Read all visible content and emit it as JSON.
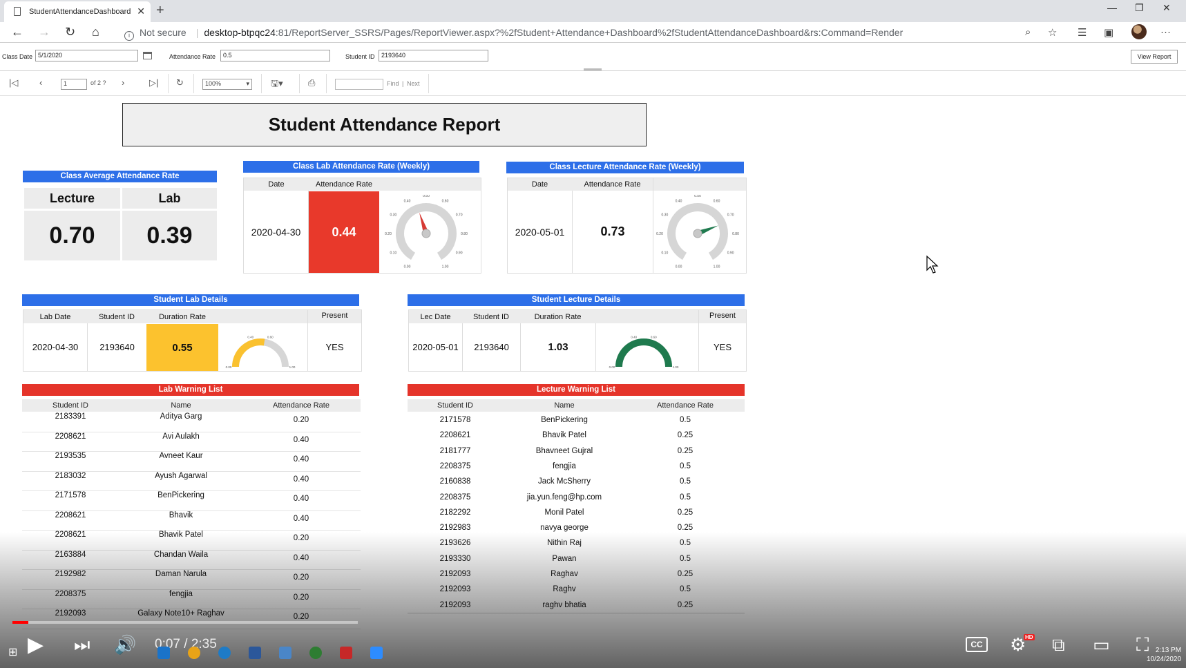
{
  "browser": {
    "tab_title": "StudentAttendanceDashboard -",
    "security": "Not secure",
    "url_host": "desktop-btpqc24",
    "url_path": ":81/ReportServer_SSRS/Pages/ReportViewer.aspx?%2fStudent+Attendance+Dashboard%2fStudentAttendanceDashboard&rs:Command=Render"
  },
  "params": {
    "class_date_label": "Class Date",
    "class_date_value": "5/1/2020",
    "attendance_rate_label": "Attendance Rate",
    "attendance_rate_value": "0.5",
    "student_id_label": "Student ID",
    "student_id_value": "2193640",
    "view_report": "View Report"
  },
  "toolbar": {
    "page_value": "1",
    "of_pages": "of 2 ?",
    "zoom": "100%",
    "find": "Find",
    "separator": "|",
    "next": "Next"
  },
  "report": {
    "title": "Student Attendance Report",
    "class_avg": {
      "header": "Class Average Attendance Rate",
      "lecture_label": "Lecture",
      "lab_label": "Lab",
      "lecture_value": "0.70",
      "lab_value": "0.39"
    },
    "lab_weekly": {
      "header": "Class Lab Attendance Rate (Weekly)",
      "col_date": "Date",
      "col_rate": "Attendance Rate",
      "date": "2020-04-30",
      "rate": "0.44",
      "gauge_value": 0.44
    },
    "lecture_weekly": {
      "header": "Class Lecture Attendance Rate (Weekly)",
      "col_date": "Date",
      "col_rate": "Attendance Rate",
      "date": "2020-05-01",
      "rate": "0.73",
      "gauge_value": 0.73
    },
    "student_lab": {
      "header": "Student Lab Details",
      "col_date": "Lab Date",
      "col_id": "Student ID",
      "col_duration": "Duration Rate",
      "col_present": "Present",
      "date": "2020-04-30",
      "id": "2193640",
      "duration": "0.55",
      "present": "YES",
      "gauge_value": 0.55
    },
    "student_lecture": {
      "header": "Student Lecture Details",
      "col_date": "Lec Date",
      "col_id": "Student ID",
      "col_duration": "Duration Rate",
      "col_present": "Present",
      "date": "2020-05-01",
      "id": "2193640",
      "duration": "1.03",
      "present": "YES",
      "gauge_value": 1.03
    },
    "lab_warning": {
      "header": "Lab Warning List",
      "col_id": "Student ID",
      "col_name": "Name",
      "col_rate": "Attendance Rate",
      "rows": [
        {
          "id": "2183391",
          "name": "Aditya Garg",
          "rate": "0.20"
        },
        {
          "id": "2208621",
          "name": "Avi Aulakh",
          "rate": "0.40"
        },
        {
          "id": "2193535",
          "name": "Avneet Kaur",
          "rate": "0.40"
        },
        {
          "id": "2183032",
          "name": "Ayush Agarwal",
          "rate": "0.40"
        },
        {
          "id": "2171578",
          "name": "BenPickering",
          "rate": "0.40"
        },
        {
          "id": "2208621",
          "name": "Bhavik",
          "rate": "0.40"
        },
        {
          "id": "2208621",
          "name": "Bhavik Patel",
          "rate": "0.20"
        },
        {
          "id": "2163884",
          "name": "Chandan Waila",
          "rate": "0.40"
        },
        {
          "id": "2192982",
          "name": "Daman Narula",
          "rate": "0.20"
        },
        {
          "id": "2208375",
          "name": "fengjia",
          "rate": "0.20"
        },
        {
          "id": "2192093",
          "name": "Galaxy Note10+ Raghav",
          "rate": "0.20"
        }
      ]
    },
    "lecture_warning": {
      "header": "Lecture Warning List",
      "col_id": "Student ID",
      "col_name": "Name",
      "col_rate": "Attendance Rate",
      "rows": [
        {
          "id": "2171578",
          "name": "BenPickering",
          "rate": "0.5"
        },
        {
          "id": "2208621",
          "name": "Bhavik Patel",
          "rate": "0.25"
        },
        {
          "id": "2181777",
          "name": "Bhavneet Gujral",
          "rate": "0.25"
        },
        {
          "id": "2208375",
          "name": "fengjia",
          "rate": "0.5"
        },
        {
          "id": "2160838",
          "name": "Jack McSherry",
          "rate": "0.5"
        },
        {
          "id": "2208375",
          "name": "jia.yun.feng@hp.com",
          "rate": "0.5"
        },
        {
          "id": "2182292",
          "name": "Monil Patel",
          "rate": "0.25"
        },
        {
          "id": "2192983",
          "name": "navya george",
          "rate": "0.25"
        },
        {
          "id": "2193626",
          "name": "Nithin Raj",
          "rate": "0.5"
        },
        {
          "id": "2193330",
          "name": "Pawan",
          "rate": "0.5"
        },
        {
          "id": "2192093",
          "name": "Raghav",
          "rate": "0.25"
        },
        {
          "id": "2192093",
          "name": "Raghv",
          "rate": "0.5"
        },
        {
          "id": "2192093",
          "name": "raghv bhatia",
          "rate": "0.25"
        }
      ]
    }
  },
  "video": {
    "time": "0:07 / 2:35",
    "progress": 0.045,
    "hd": "HD",
    "cc": "CC"
  },
  "taskbar": {
    "time": "2:13 PM",
    "date": "10/24/2020"
  },
  "colors": {
    "header_blue": "#2d6fe8",
    "header_red": "#e5342a",
    "lab_rate_fill": "#e8392b",
    "duration_fill": "#fcc22e",
    "gauge_red_needle": "#d63a34",
    "gauge_green_needle": "#1f7a4e",
    "gauge_yellow_arc": "#fac12f",
    "gauge_green_arc": "#1f7a4e"
  }
}
